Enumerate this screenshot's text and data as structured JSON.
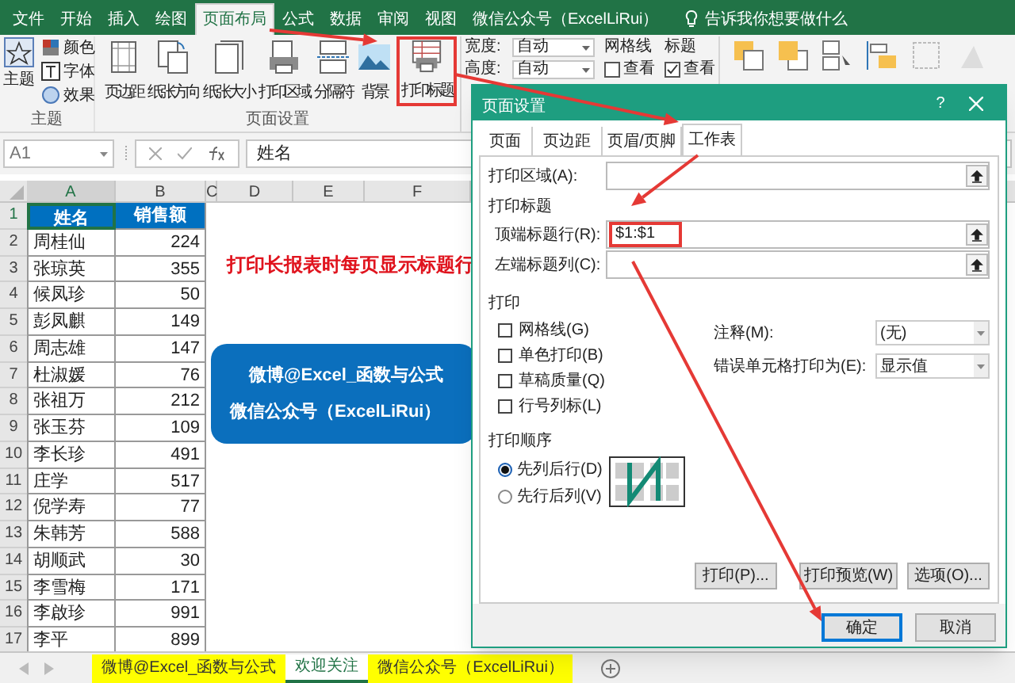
{
  "menu_tabs": [
    {
      "label": "文件",
      "selected": false
    },
    {
      "label": "开始",
      "selected": false
    },
    {
      "label": "插入",
      "selected": false
    },
    {
      "label": "绘图",
      "selected": false
    },
    {
      "label": "页面布局",
      "selected": true
    },
    {
      "label": "公式",
      "selected": false
    },
    {
      "label": "数据",
      "selected": false
    },
    {
      "label": "审阅",
      "selected": false
    },
    {
      "label": "视图",
      "selected": false
    },
    {
      "label": "微信公众号（ExcelLiRui）",
      "selected": false
    }
  ],
  "tell_me": "告诉我你想要做什么",
  "ribbon": {
    "themes_group": {
      "label": "主题",
      "button": "主题",
      "items": [
        "颜色",
        "字体",
        "效果"
      ]
    },
    "page_setup_group": {
      "label": "页面设置",
      "buttons": [
        {
          "label": "页边距",
          "kind": "margins",
          "highlighted": false
        },
        {
          "label": "纸张方向",
          "kind": "orientation",
          "highlighted": false
        },
        {
          "label": "纸张大小",
          "kind": "size",
          "highlighted": false
        },
        {
          "label": "打印区域",
          "kind": "printer",
          "highlighted": false
        },
        {
          "label": "分隔符",
          "kind": "breaks",
          "highlighted": false
        },
        {
          "label": "背景",
          "kind": "background",
          "highlighted": false
        },
        {
          "label": "打印标题",
          "kind": "titles",
          "highlighted": true
        }
      ]
    },
    "scale": [
      {
        "label": "宽度:",
        "value": "自动"
      },
      {
        "label": "高度:",
        "value": "自动"
      }
    ],
    "sheet_options": [
      {
        "label": "网格线",
        "option": "查看",
        "checked": false
      },
      {
        "label": "标题",
        "option": "查看",
        "checked": true
      }
    ]
  },
  "formula_bar": {
    "name_box": "A1",
    "value": "姓名"
  },
  "columns": [
    "A",
    "B",
    "C",
    "D",
    "E",
    "F"
  ],
  "rows": [
    {
      "number": "1",
      "name": "姓名",
      "sales": "销售额"
    },
    {
      "number": "2",
      "name": "周桂仙",
      "sales": "224"
    },
    {
      "number": "3",
      "name": "张琼英",
      "sales": "355"
    },
    {
      "number": "4",
      "name": "候凤珍",
      "sales": "50"
    },
    {
      "number": "5",
      "name": "彭凤麒",
      "sales": "149"
    },
    {
      "number": "6",
      "name": "周志雄",
      "sales": "147"
    },
    {
      "number": "7",
      "name": "杜淑媛",
      "sales": "76"
    },
    {
      "number": "8",
      "name": "张祖万",
      "sales": "212"
    },
    {
      "number": "9",
      "name": "张玉芬",
      "sales": "109"
    },
    {
      "number": "10",
      "name": "李长珍",
      "sales": "491"
    },
    {
      "number": "11",
      "name": "庄学",
      "sales": "517"
    },
    {
      "number": "12",
      "name": "倪学寿",
      "sales": "77"
    },
    {
      "number": "13",
      "name": "朱韩芳",
      "sales": "588"
    },
    {
      "number": "14",
      "name": "胡顺武",
      "sales": "30"
    },
    {
      "number": "15",
      "name": "李雪梅",
      "sales": "171"
    },
    {
      "number": "16",
      "name": "李啟珍",
      "sales": "991"
    },
    {
      "number": "17",
      "name": "李平",
      "sales": "899"
    }
  ],
  "headline": "打印长报表时每页显示标题行",
  "banner": [
    "微博@Excel_函数与公式",
    "微信公众号（ExcelLiRui）"
  ],
  "sheet_tabs": [
    {
      "label": "微博@Excel_函数与公式",
      "selected": false
    },
    {
      "label": "欢迎关注",
      "selected": true
    },
    {
      "label": "微信公众号（ExcelLiRui）",
      "selected": false
    }
  ],
  "dialog": {
    "title": "页面设置",
    "help": "?",
    "tabs": [
      {
        "label": "页面",
        "selected": false
      },
      {
        "label": "页边距",
        "selected": false
      },
      {
        "label": "页眉/页脚",
        "selected": false
      },
      {
        "label": "工作表",
        "selected": true
      }
    ],
    "print_area": {
      "label": "打印区域(A):"
    },
    "print_titles": {
      "label": "打印标题",
      "fields": [
        {
          "label": "顶端标题行(R):",
          "value": "$1:$1",
          "highlighted": true
        },
        {
          "label": "左端标题列(C):",
          "highlighted": false
        }
      ]
    },
    "print": {
      "label": "打印",
      "checkboxes": [
        {
          "label": "网格线(G)",
          "checked": false
        },
        {
          "label": "单色打印(B)",
          "checked": false
        },
        {
          "label": "草稿质量(Q)",
          "checked": false
        },
        {
          "label": "行号列标(L)",
          "checked": false
        }
      ],
      "dropdowns": [
        {
          "label": "注释(M):",
          "value": "(无)"
        },
        {
          "label": "错误单元格打印为(E):",
          "value": "显示值"
        }
      ]
    },
    "page_order": {
      "label": "打印顺序",
      "options": [
        {
          "label": "先列后行(D)",
          "selected": true
        },
        {
          "label": "先行后列(V)",
          "selected": false
        }
      ]
    },
    "actions": [
      "打印(P)...",
      "打印预览(W)",
      "选项(O)..."
    ],
    "footer": [
      {
        "label": "确定",
        "default": true
      },
      {
        "label": "取消",
        "default": false
      }
    ]
  }
}
